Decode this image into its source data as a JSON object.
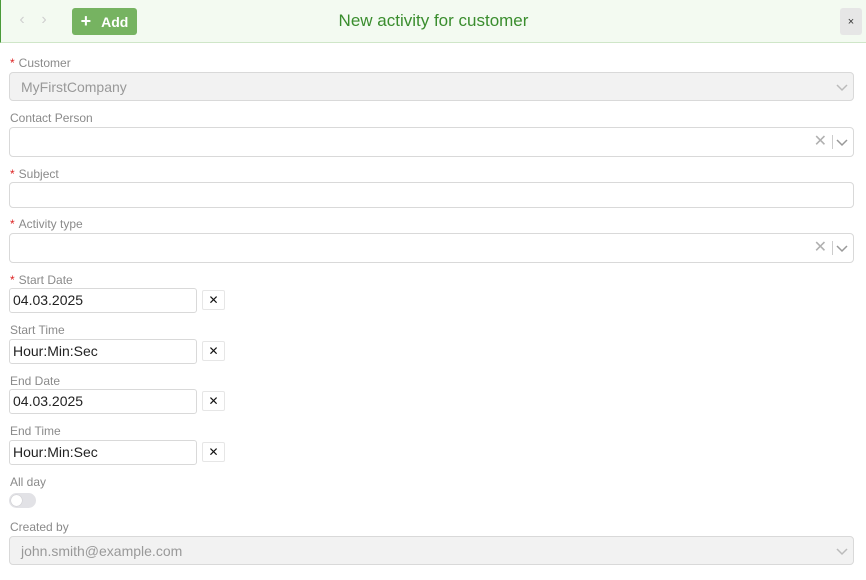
{
  "header": {
    "prev_icon": "chevron-left-icon",
    "next_icon": "chevron-right-icon",
    "add_label": "Add",
    "add_icon": "plus",
    "title": "New activity for customer",
    "close_icon": "×",
    "accent_color": "#76b361",
    "title_color": "#3a8d2e"
  },
  "form": {
    "customer": {
      "label": "Customer",
      "required": true,
      "value": "MyFirstCompany"
    },
    "contact_person": {
      "label": "Contact Person",
      "value": ""
    },
    "subject": {
      "label": "Subject",
      "required": true,
      "value": ""
    },
    "activity_type": {
      "label": "Activity type",
      "required": true,
      "value": ""
    },
    "start_date": {
      "label": "Start Date",
      "required": true,
      "value": "04.03.2025"
    },
    "start_time": {
      "label": "Start Time",
      "placeholder": "Hour:Min:Sec"
    },
    "end_date": {
      "label": "End Date",
      "value": "04.03.2025"
    },
    "end_time": {
      "label": "End Time",
      "placeholder": "Hour:Min:Sec"
    },
    "all_day": {
      "label": "All day",
      "on": false
    },
    "created_by": {
      "label": "Created by",
      "value": "john.smith@example.com"
    },
    "clear_icon": "✕",
    "required_marker": "*"
  }
}
